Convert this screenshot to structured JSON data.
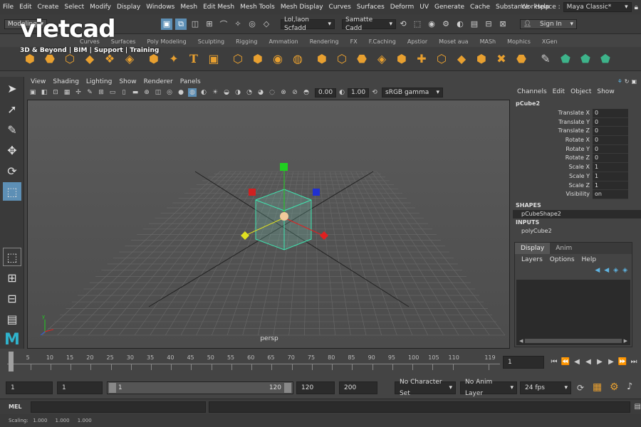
{
  "menu": {
    "items": [
      "File",
      "Edit",
      "Create",
      "Select",
      "Modify",
      "Display",
      "Windows",
      "Mesh",
      "Edit Mesh",
      "Mesh Tools",
      "Mesh Display",
      "Curves",
      "Surfaces",
      "Deform",
      "UV",
      "Generate",
      "Cache",
      "Substance",
      "Help"
    ],
    "workspace_label": "Workspace :",
    "workspace_value": "Maya Classic*"
  },
  "status": {
    "mode": "Modeling",
    "selection_dropdown": "Lol,laon Scfadd",
    "symmetry_dropdown": "Samatte Cadd",
    "sign_in": "Sign In"
  },
  "logo": {
    "name": "vietcad",
    "tagline": "3D & Beyond | BIM | Support | Training"
  },
  "shelf_tabs": [
    "Curves",
    "Surfaces",
    "Poly Modeling",
    "Sculpting",
    "Rigging",
    "Ammation",
    "Rendering",
    "FX",
    "F.Caching",
    "Apstior",
    "Moset aua",
    "MASh",
    "Mophics",
    "XGen"
  ],
  "viewport": {
    "menu": [
      "View",
      "Shading",
      "Lighting",
      "Show",
      "Renderer",
      "Panels"
    ],
    "field1": "0.00",
    "field2": "1.00",
    "colorspace": "sRGB gamma",
    "camera": "persp"
  },
  "channel_box": {
    "menu": [
      "Channels",
      "Edit",
      "Object",
      "Show"
    ],
    "object": "pCube2",
    "attributes": [
      {
        "name": "Translate X",
        "value": "0"
      },
      {
        "name": "Translate Y",
        "value": "0"
      },
      {
        "name": "Translate Z",
        "value": "0"
      },
      {
        "name": "Rotate X",
        "value": "0"
      },
      {
        "name": "Rotate Y",
        "value": "0"
      },
      {
        "name": "Rotate Z",
        "value": "0"
      },
      {
        "name": "Scale X",
        "value": "1"
      },
      {
        "name": "Scale Y",
        "value": "1"
      },
      {
        "name": "Scale Z",
        "value": "1"
      },
      {
        "name": "Visibility",
        "value": "on"
      }
    ],
    "shapes_header": "SHAPES",
    "shape_item": "pCubeShape2",
    "inputs_header": "INPUTS",
    "input_item": "polyCube2"
  },
  "layer_editor": {
    "tabs": [
      "Display",
      "Anim"
    ],
    "menu": [
      "Layers",
      "Options",
      "Help"
    ]
  },
  "timeline": {
    "ticks": [
      "5",
      "10",
      "15",
      "20",
      "25",
      "30",
      "35",
      "40",
      "45",
      "50",
      "55",
      "60",
      "65",
      "70",
      "75",
      "80",
      "85",
      "90",
      "95",
      "100",
      "105",
      "110",
      "119"
    ],
    "current_frame": "1"
  },
  "range": {
    "start": "1",
    "start_inner": "1",
    "slider_start": "1",
    "slider_end": "120",
    "end_inner": "120",
    "end": "200",
    "character_set": "No Character Set",
    "anim_layer": "No Anim Layer",
    "fps": "24 fps"
  },
  "command": {
    "label": "MEL"
  },
  "help": {
    "text": "Scaling:   1.000     1.000     1.000"
  }
}
